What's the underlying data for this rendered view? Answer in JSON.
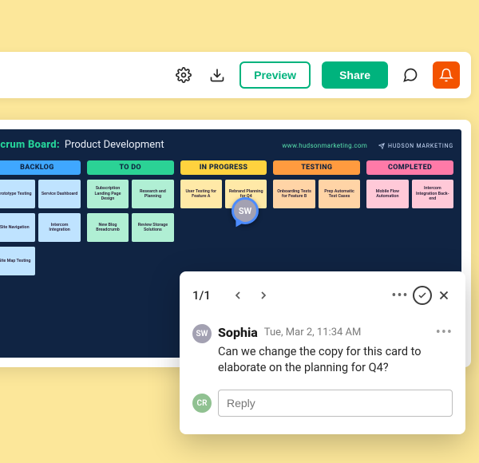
{
  "toolbar": {
    "preview_label": "Preview",
    "share_label": "Share"
  },
  "board": {
    "title_prefix": "Scrum Board:",
    "title_subject": "Product Development",
    "site_link": "www.hudsonmarketing.com",
    "brand": "HUDSON MARKETING"
  },
  "columns": [
    {
      "label": "BACKLOG",
      "head_color": "#3fa7ff",
      "card_color": "#bfe3ff",
      "rows": [
        [
          "Prototype Testing",
          "Service Dashboard"
        ],
        [
          "Site Navigation",
          "Intercom Integration"
        ],
        [
          "Site Map Testing"
        ]
      ]
    },
    {
      "label": "TO DO",
      "head_color": "#2bd295",
      "card_color": "#b0efd4",
      "rows": [
        [
          "Subscription Landing Page Design",
          "Research and Planning"
        ],
        [
          "New Blog Breadcrumb",
          "Review Storage Solutions"
        ]
      ]
    },
    {
      "label": "IN PROGRESS",
      "head_color": "#ffd23e",
      "card_color": "#ffe9a7",
      "rows": [
        [
          "User Testing for Feature A",
          "Rebrand Planning for Q4"
        ]
      ]
    },
    {
      "label": "TESTING",
      "head_color": "#ff9b3f",
      "card_color": "#ffd4a6",
      "rows": [
        [
          "Onboarding Tests for Feature B",
          "Prep Automatic Test Cases"
        ]
      ]
    },
    {
      "label": "COMPLETED",
      "head_color": "#ff7aa8",
      "card_color": "#ffc9d8",
      "rows": [
        [
          "Mobile Flow Automation",
          "Intercom Integration Back-end"
        ]
      ]
    }
  ],
  "active_user": {
    "initials": "SW",
    "avatar_color": "#a3a1b2"
  },
  "comment_panel": {
    "pager": "1/1",
    "author_name": "Sophia",
    "author_initials": "SW",
    "author_avatar_color": "#a3a1b2",
    "timestamp": "Tue, Mar 2, 11:34 AM",
    "body": "Can we change the copy for this card to elaborate on the planning for Q4?",
    "reply_placeholder": "Reply",
    "reply_avatar_initials": "CR",
    "reply_avatar_color": "#90c191"
  }
}
